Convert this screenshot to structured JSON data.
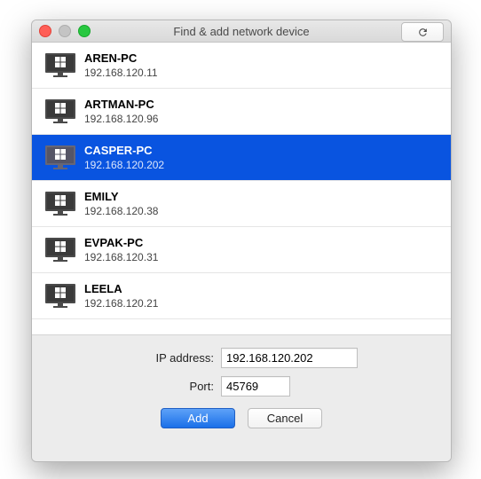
{
  "window_title": "Find & add network device",
  "devices": [
    {
      "name": "AREN-PC",
      "ip": "192.168.120.11",
      "selected": false
    },
    {
      "name": "ARTMAN-PC",
      "ip": "192.168.120.96",
      "selected": false
    },
    {
      "name": "CASPER-PC",
      "ip": "192.168.120.202",
      "selected": true
    },
    {
      "name": "EMILY",
      "ip": "192.168.120.38",
      "selected": false
    },
    {
      "name": "EVPAK-PC",
      "ip": "192.168.120.31",
      "selected": false
    },
    {
      "name": "LEELA",
      "ip": "192.168.120.21",
      "selected": false
    }
  ],
  "form": {
    "ip_label": "IP address:",
    "ip_value": "192.168.120.202",
    "port_label": "Port:",
    "port_value": "45769",
    "add_button": "Add",
    "cancel_button": "Cancel"
  },
  "colors": {
    "selection_bg": "#0954e0",
    "window_bg": "#ececec"
  }
}
